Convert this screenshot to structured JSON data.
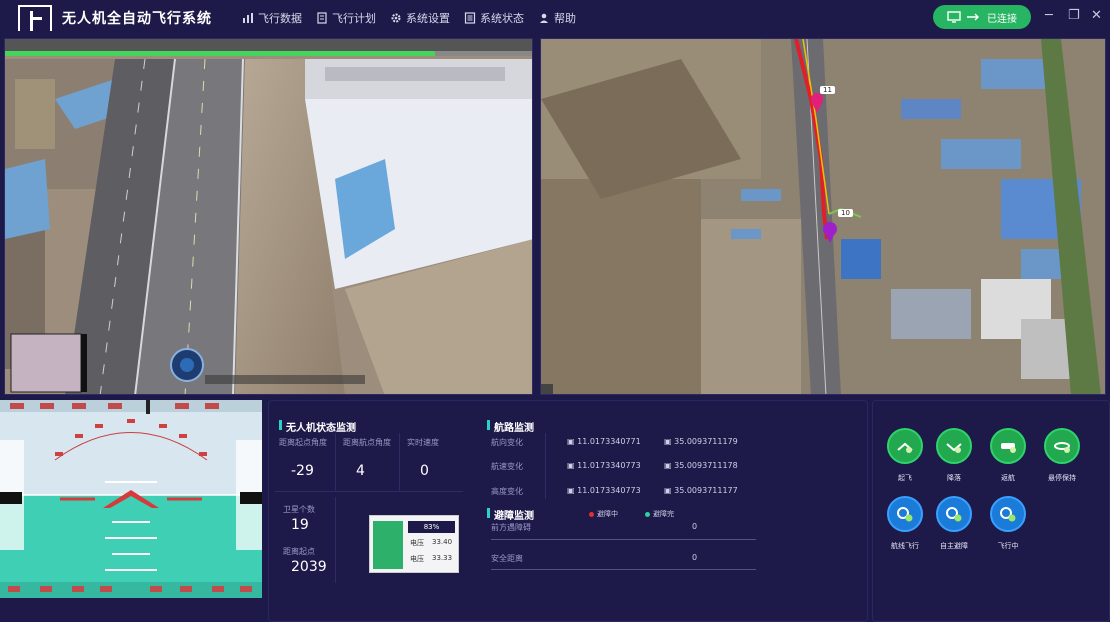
{
  "app": {
    "title": "无人机全自动飞行系统"
  },
  "nav": [
    {
      "label": "飞行数据",
      "icon": "bar-chart-icon"
    },
    {
      "label": "飞行计划",
      "icon": "document-icon"
    },
    {
      "label": "系统设置",
      "icon": "gear-icon"
    },
    {
      "label": "系统状态",
      "icon": "list-icon"
    },
    {
      "label": "帮助",
      "icon": "user-icon"
    }
  ],
  "connection": {
    "label": "已连接",
    "color": "#27b463"
  },
  "monitor": {
    "title": "无人机状态监测",
    "fields": [
      {
        "label": "距离起点角度",
        "value": "-29"
      },
      {
        "label": "距离航点角度",
        "value": "4"
      },
      {
        "label": "实时速度",
        "value": "0"
      },
      {
        "label": "卫星个数",
        "value": "19"
      },
      {
        "label": "距离起点",
        "value": "2039"
      }
    ],
    "battery": {
      "header": "83%",
      "rows": [
        {
          "k": "电压",
          "v": "33.40"
        },
        {
          "k": "电压",
          "v": "33.33"
        }
      ]
    }
  },
  "status": {
    "title": "航路监测",
    "rows": [
      {
        "label": "航向变化",
        "a": "11.0173340771",
        "b": "35.0093711179"
      },
      {
        "label": "航速变化",
        "a": "11.0173340773",
        "b": "35.0093711178"
      },
      {
        "label": "高度变化",
        "a": "11.0173340773",
        "b": "35.0093711177"
      }
    ]
  },
  "obstacle": {
    "title": "避障监测",
    "legend": [
      {
        "label": "避障中",
        "color": "#e03030"
      },
      {
        "label": "避障完",
        "color": "#2bd2a0"
      }
    ],
    "rows": [
      {
        "label": "前方遇障碍",
        "value": "0"
      },
      {
        "label": "安全距离",
        "value": "0"
      }
    ]
  },
  "actions": {
    "colors": {
      "green": "#22a84f",
      "blue": "#1b7bd8"
    },
    "items": [
      {
        "label": "起飞",
        "style": "green"
      },
      {
        "label": "降落",
        "style": "green"
      },
      {
        "label": "返航",
        "style": "green"
      },
      {
        "label": "悬停保持",
        "style": "green"
      },
      {
        "label": "航线飞行",
        "style": "blue"
      },
      {
        "label": "自主避障",
        "style": "blue"
      },
      {
        "label": "飞行中",
        "style": "blue"
      }
    ]
  },
  "map": {
    "markers": [
      {
        "label": "11"
      },
      {
        "label": "10"
      }
    ]
  }
}
